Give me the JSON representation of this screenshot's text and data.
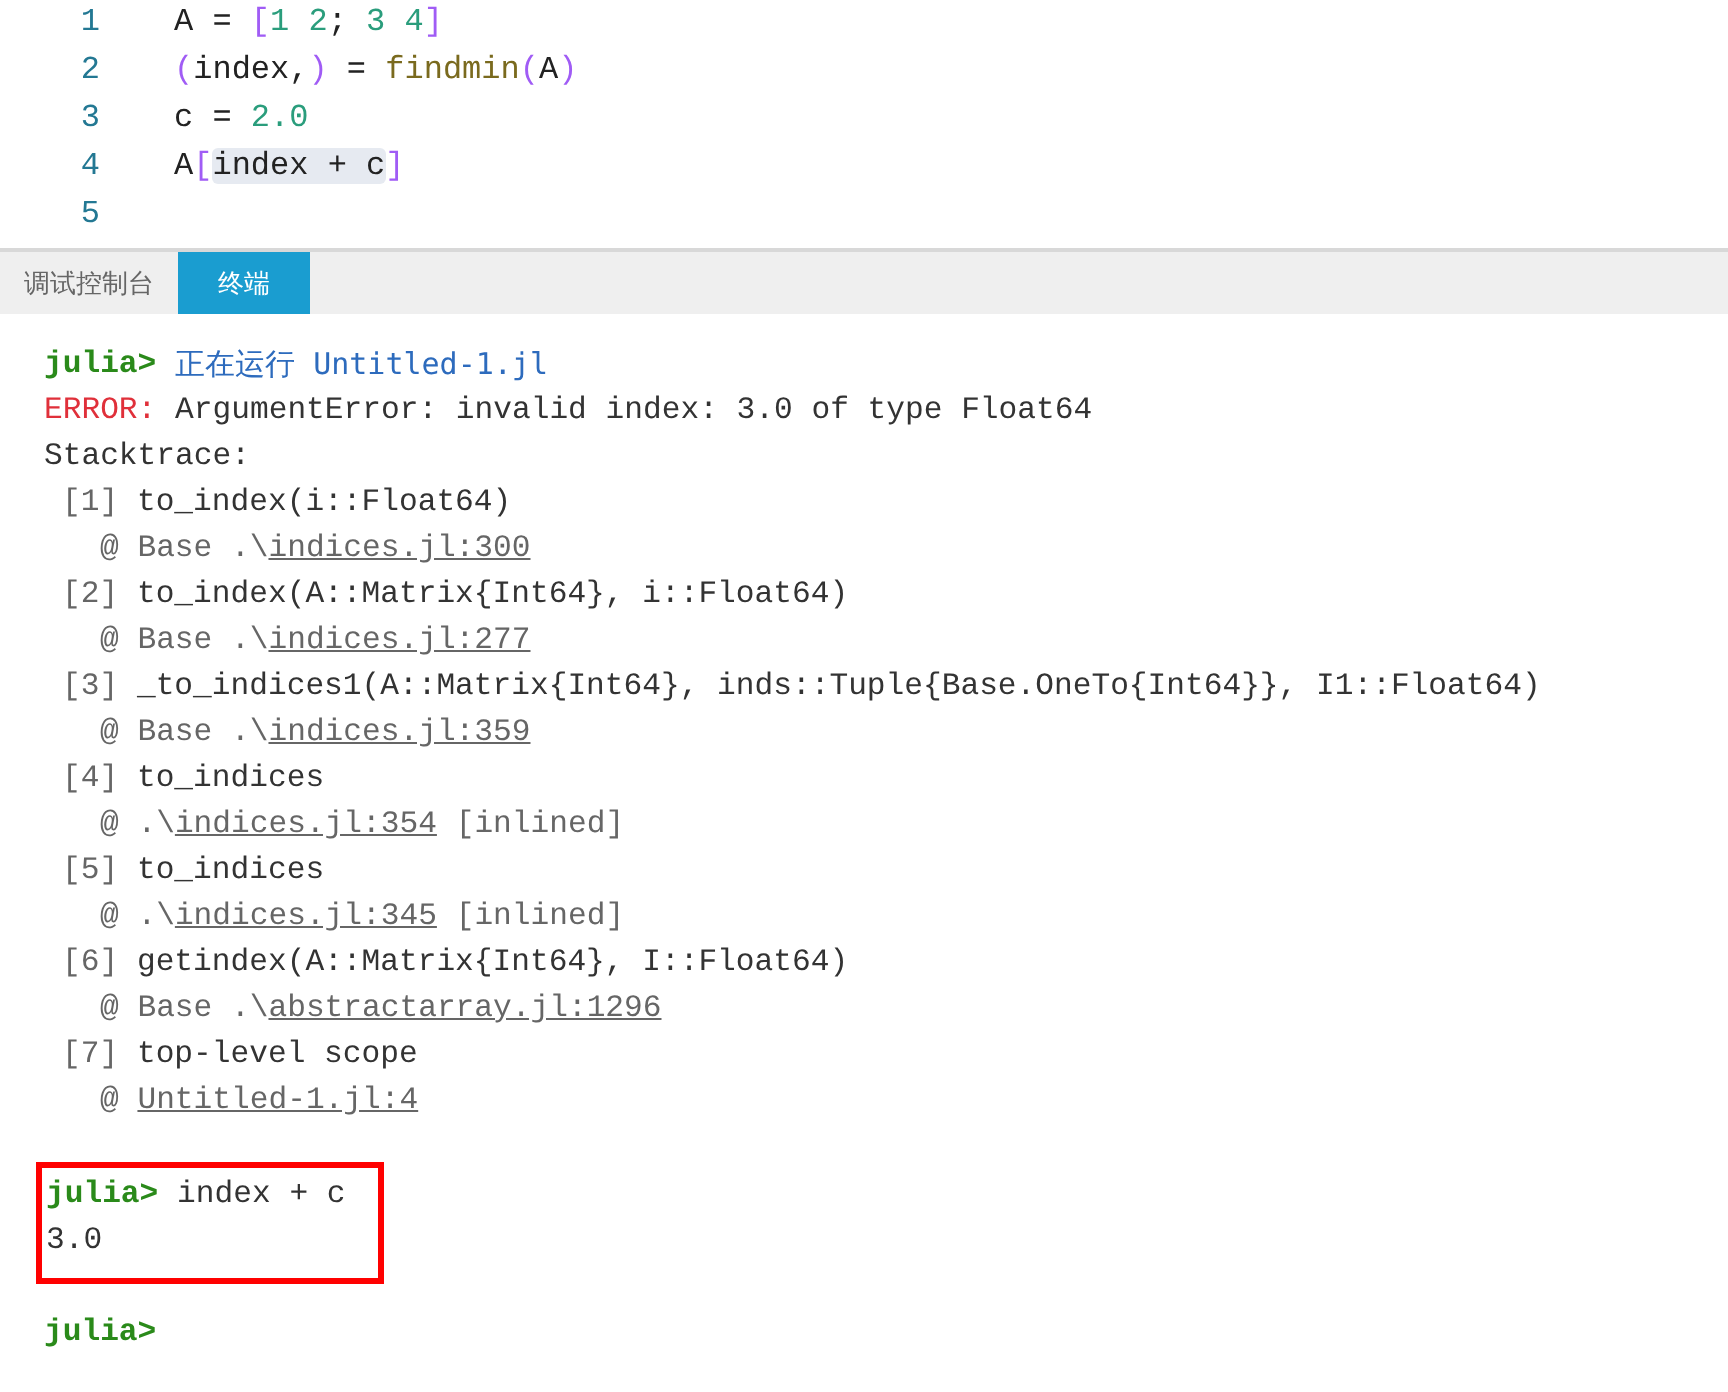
{
  "editor": {
    "lines": [
      {
        "number": "1",
        "tokens": [
          {
            "kind": "plain",
            "text": "A = "
          },
          {
            "kind": "bracket",
            "text": "["
          },
          {
            "kind": "number",
            "text": "1 2"
          },
          {
            "kind": "plain",
            "text": "; "
          },
          {
            "kind": "number",
            "text": "3 4"
          },
          {
            "kind": "bracket",
            "text": "]"
          }
        ]
      },
      {
        "number": "2",
        "tokens": [
          {
            "kind": "bracket",
            "text": "("
          },
          {
            "kind": "plain",
            "text": "index,"
          },
          {
            "kind": "bracket",
            "text": ")"
          },
          {
            "kind": "plain",
            "text": " = "
          },
          {
            "kind": "func",
            "text": "findmin"
          },
          {
            "kind": "bracket",
            "text": "("
          },
          {
            "kind": "plain",
            "text": "A"
          },
          {
            "kind": "bracket",
            "text": ")"
          }
        ]
      },
      {
        "number": "3",
        "tokens": [
          {
            "kind": "plain",
            "text": "c = "
          },
          {
            "kind": "number",
            "text": "2.0"
          }
        ]
      },
      {
        "number": "4",
        "tokens": [
          {
            "kind": "plain",
            "text": "A"
          },
          {
            "kind": "bracket",
            "text": "["
          },
          {
            "kind": "selection",
            "text": "index + c"
          },
          {
            "kind": "bracket",
            "text": "]"
          }
        ]
      },
      {
        "number": "5"
      }
    ]
  },
  "tabs": [
    {
      "label": "调试控制台",
      "selected": false
    },
    {
      "label": "终端",
      "selected": true
    }
  ],
  "terminal": {
    "lines": [
      {
        "kind": "prompt",
        "prompt": "julia>",
        "text": "正在运行 Untitled-1.jl"
      },
      {
        "kind": "error",
        "label": "ERROR:",
        "text": "ArgumentError: invalid index: 3.0 of type Float64"
      },
      {
        "kind": "plain",
        "text": "Stacktrace:"
      },
      {
        "kind": "frame",
        "index": "[1]",
        "text": "to_index(i::Float64)"
      },
      {
        "kind": "location",
        "prefix": "@ Base .\\",
        "link": "indices.jl:300"
      },
      {
        "kind": "frame",
        "index": "[2]",
        "text": "to_index(A::Matrix{Int64}, i::Float64)"
      },
      {
        "kind": "location",
        "prefix": "@ Base .\\",
        "link": "indices.jl:277"
      },
      {
        "kind": "frame",
        "index": "[3]",
        "text": "_to_indices1(A::Matrix{Int64}, inds::Tuple{Base.OneTo{Int64}}, I1::Float64)"
      },
      {
        "kind": "location",
        "prefix": "@ Base .\\",
        "link": "indices.jl:359"
      },
      {
        "kind": "frame",
        "index": "[4]",
        "text": "to_indices"
      },
      {
        "kind": "location",
        "prefix": "@ .\\",
        "link": "indices.jl:354",
        "suffix": "[inlined]"
      },
      {
        "kind": "frame",
        "index": "[5]",
        "text": "to_indices"
      },
      {
        "kind": "location",
        "prefix": "@ .\\",
        "link": "indices.jl:345",
        "suffix": "[inlined]"
      },
      {
        "kind": "frame",
        "index": "[6]",
        "text": "getindex(A::Matrix{Int64}, I::Float64)"
      },
      {
        "kind": "location",
        "prefix": "@ Base .\\",
        "link": "abstractarray.jl:1296"
      },
      {
        "kind": "frame",
        "index": "[7]",
        "text": "top-level scope"
      },
      {
        "kind": "location",
        "prefix": "@ ",
        "link": "Untitled-1.jl:4"
      }
    ],
    "highlight": {
      "prompt": "julia>",
      "input": "index + c",
      "output": "3.0"
    },
    "final_prompt": "julia>"
  }
}
